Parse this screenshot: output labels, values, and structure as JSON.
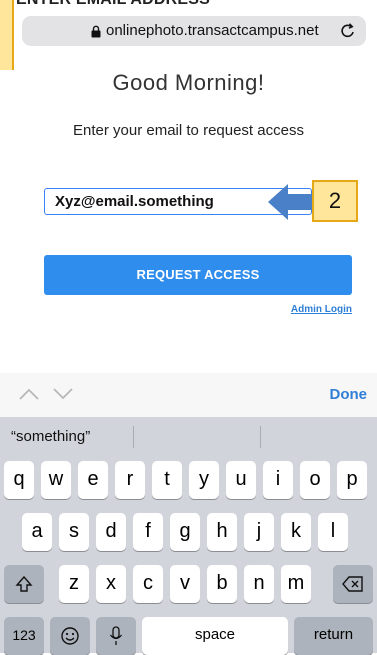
{
  "top_caption": "ENTER EMAIL ADDRESS",
  "browser": {
    "url": "onlinephoto.transactcampus.net"
  },
  "page": {
    "greeting": "Good Morning!",
    "prompt": "Enter your email to request access",
    "email_value": "Xyz@email.something",
    "request_button": "REQUEST ACCESS",
    "admin_link": "Admin Login"
  },
  "annotation": {
    "step": "2",
    "color": "#ffe69a",
    "border": "#e6a817",
    "arrow_color": "#4a80c8"
  },
  "keyboard": {
    "done": "Done",
    "suggestion": "“something”",
    "row1": [
      "q",
      "w",
      "e",
      "r",
      "t",
      "y",
      "u",
      "i",
      "o",
      "p"
    ],
    "row2": [
      "a",
      "s",
      "d",
      "f",
      "g",
      "h",
      "j",
      "k",
      "l"
    ],
    "row3": [
      "z",
      "x",
      "c",
      "v",
      "b",
      "n",
      "m"
    ],
    "numbers_key": "123",
    "space_key": "space",
    "return_key": "return"
  },
  "colors": {
    "accent": "#2f8ded",
    "link": "#2f7fd6"
  }
}
